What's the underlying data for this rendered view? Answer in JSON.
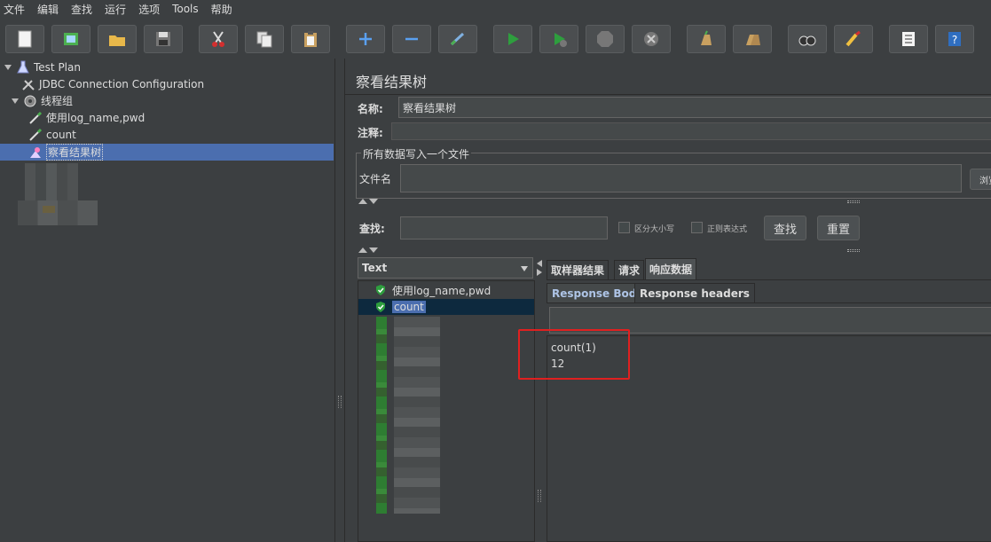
{
  "menu": [
    "文件",
    "编辑",
    "查找",
    "运行",
    "选项",
    "Tools",
    "帮助"
  ],
  "toolbar_icons": [
    "new-icon",
    "templates-icon",
    "open-icon",
    "save-icon",
    "cut-icon",
    "copy-icon",
    "paste-icon",
    "expand-icon",
    "collapse-icon",
    "toggle-icon",
    "start-icon",
    "start-no-pause-icon",
    "stop-icon",
    "shutdown-icon",
    "clear-icon",
    "clear-all-icon",
    "search-icon",
    "reset-search-icon",
    "function-helper-icon",
    "help-icon"
  ],
  "tree": {
    "test_plan": "Test Plan",
    "jdbc_config": "JDBC Connection Configuration",
    "thread_group": "线程组",
    "sampler1": "使用log_name,pwd",
    "sampler2": "count",
    "listener": "察看结果树"
  },
  "panel": {
    "title": "察看结果树",
    "name_label": "名称:",
    "name_value": "察看结果树",
    "comment_label": "注释:",
    "file_group_title": "所有数据写入一个文件",
    "file_label": "文件名",
    "browse_label": "浏览",
    "search_label": "查找:",
    "case_label": "区分大小写",
    "regex_label": "正则表达式",
    "find_button": "查找",
    "reset_button": "重置",
    "renderer": "Text"
  },
  "results": [
    {
      "label": "使用log_name,pwd",
      "status": "success"
    },
    {
      "label": "count",
      "status": "success",
      "selected": true
    }
  ],
  "tabs": [
    "取样器结果",
    "请求",
    "响应数据"
  ],
  "subtabs": [
    "Response Body",
    "Response headers"
  ],
  "response_lines": [
    "count(1)",
    "12"
  ],
  "colors": {
    "background": "#3c3f41",
    "selection": "#4b6eaf",
    "success_green": "#2e9e3e",
    "highlight_red": "#e02020"
  }
}
